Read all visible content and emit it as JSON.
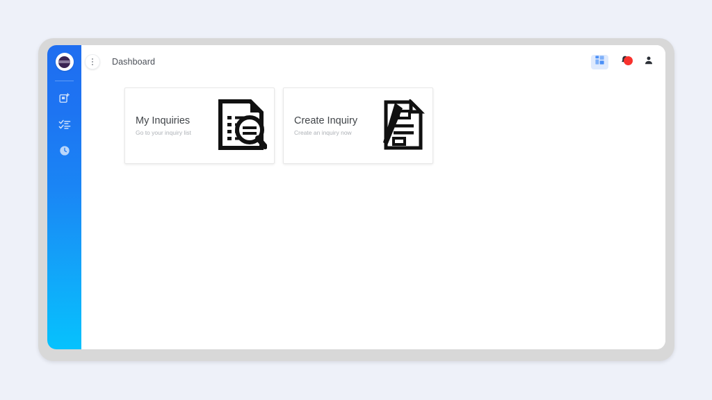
{
  "app": {
    "background_color": "#eef1f9",
    "frame_color": "#d8d8d8",
    "accent_top": "#1f6ef0",
    "accent_bottom": "#06c2fd",
    "badge_color": "#f8322d"
  },
  "sidebar": {
    "logo": {
      "name": "app-logo",
      "mark_color": "#3a2352"
    },
    "items": [
      {
        "icon": "create-document-icon",
        "label": "Create"
      },
      {
        "icon": "task-list-icon",
        "label": "Tasks"
      },
      {
        "icon": "clock-history-icon",
        "label": "History"
      }
    ]
  },
  "header": {
    "menu_icon": "kebab-menu-icon",
    "breadcrumb": "Dashboard",
    "actions": [
      {
        "icon": "apps-grid-icon",
        "label": "Apps"
      },
      {
        "icon": "notification-bell-icon",
        "label": "Notifications",
        "badge": ""
      },
      {
        "icon": "user-account-icon",
        "label": "Account"
      }
    ]
  },
  "main": {
    "cards": [
      {
        "title": "My Inquiries",
        "subtitle": "Go to your inquiry list",
        "icon": "document-search-icon"
      },
      {
        "title": "Create Inquiry",
        "subtitle": "Create an inquiry now",
        "icon": "document-pen-icon"
      }
    ]
  }
}
